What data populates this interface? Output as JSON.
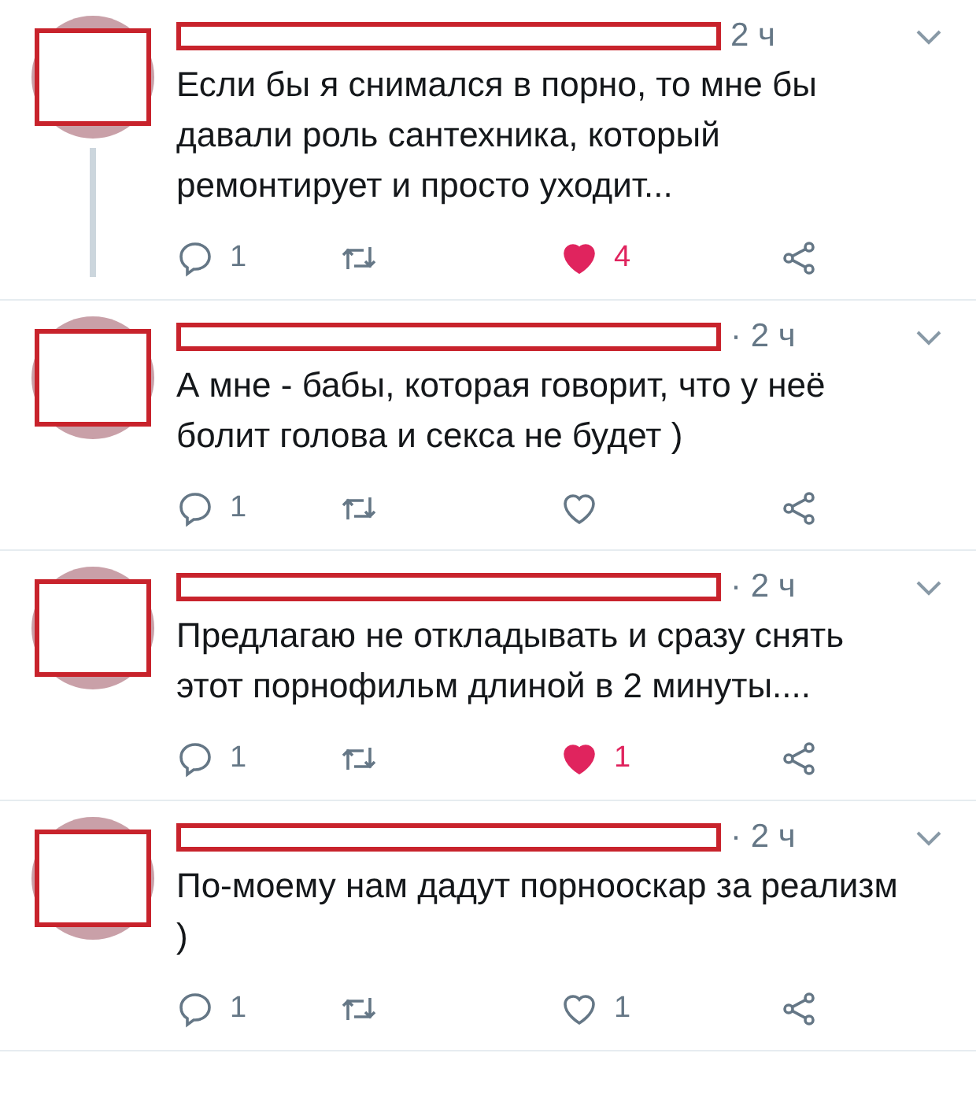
{
  "tweets": [
    {
      "time": "2 ч",
      "text": "Если бы я снимался в порно, то мне бы давали роль сантехника, который ремонтирует и просто уходит...",
      "replies": "1",
      "liked": true,
      "likes": "4"
    },
    {
      "time": "· 2 ч",
      "text": "А мне - бабы, которая говорит, что у неё болит голова и секса не будет )",
      "replies": "1",
      "liked": false
    },
    {
      "time": "· 2 ч",
      "text": "Предлагаю не откладывать и сразу снять этот порнофильм длиной в 2 минуты....",
      "replies": "1",
      "liked": true,
      "likes": "1"
    },
    {
      "time": "· 2 ч",
      "text": "По-моему нам дадут порнооскар за реализм )",
      "replies": "1",
      "liked": false,
      "likes": "1"
    }
  ]
}
